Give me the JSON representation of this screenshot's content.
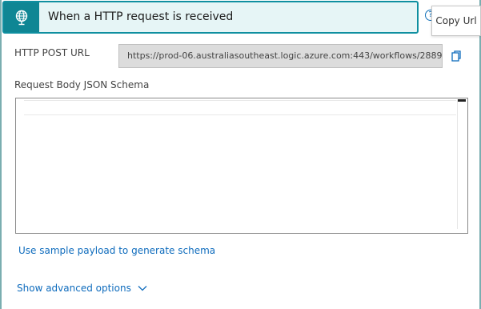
{
  "header": {
    "title": "When a HTTP request is received",
    "trigger_icon": "globe-request-icon",
    "help_icon": "question-circle-icon",
    "help_glyph": "?"
  },
  "tooltip": {
    "text": "Copy Url"
  },
  "url_section": {
    "label": "HTTP POST URL",
    "value": "https://prod-06.australiasoutheast.logic.azure.com:443/workflows/2889...",
    "copy_icon": "copy-icon"
  },
  "schema_section": {
    "label": "Request Body JSON Schema",
    "value": ""
  },
  "links": {
    "sample_payload": "Use sample payload to generate schema",
    "advanced": "Show advanced options",
    "advanced_icon": "chevron-down-icon"
  },
  "colors": {
    "accent": "#0f8694",
    "link": "#0f6cbd"
  }
}
